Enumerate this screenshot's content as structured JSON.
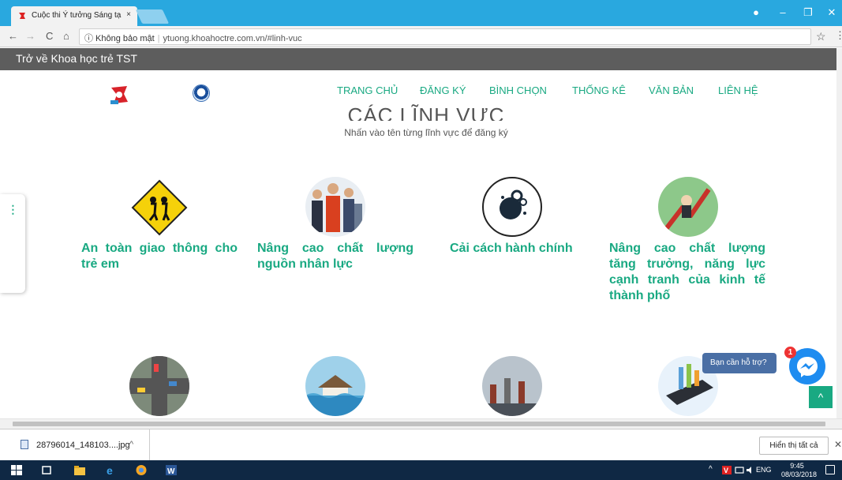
{
  "browser": {
    "tab_title": "Cuộc thi Ý tưởng Sáng tạ",
    "tab_close": "×",
    "back": "←",
    "forward": "→",
    "reload": "C",
    "home": "⌂",
    "security_label": "ⓘ Không bảo mật",
    "url": "ytuong.khoahoctre.com.vn/#linh-vuc",
    "star": "☆",
    "menu": "⋮",
    "win_account": "●",
    "win_minimize": "–",
    "win_restore": "❐",
    "win_close": "✕"
  },
  "page": {
    "back_link": "Trở về Khoa học trẻ TST",
    "nav": [
      "TRANG CHỦ",
      "ĐĂNG KÝ",
      "BÌNH CHỌN",
      "THỐNG KÊ",
      "VĂN BẢN",
      "LIÊN HỆ"
    ],
    "section_title": "CÁC LĨNH VỰC",
    "section_subtitle": "Nhấn vào tên từng lĩnh vực để đăng ký",
    "cards": [
      {
        "label": "An toàn giao thông cho trẻ em"
      },
      {
        "label": "Nâng cao chất lượng nguồn nhân lực"
      },
      {
        "label": "Cải cách hành chính"
      },
      {
        "label": "Nâng cao chất lượng tăng trưởng, năng lực cạnh tranh của kinh tế thành phố"
      }
    ],
    "help_text": "Bạn cần hỗ trợ?",
    "messenger_badge": "1",
    "to_top": "^"
  },
  "downloads": {
    "file_name": "28796014_148103....jpg",
    "chevron": "^",
    "show_all": "Hiển thị tất cả",
    "close": "✕"
  },
  "taskbar": {
    "language": "ENG",
    "time": "9:45",
    "date": "08/03/2018",
    "tray_chevron": "^"
  },
  "colors": {
    "accent": "#19a982",
    "titlebar": "#29a8df",
    "back_bar": "#5d5d5d",
    "taskbar": "#0f2844"
  }
}
